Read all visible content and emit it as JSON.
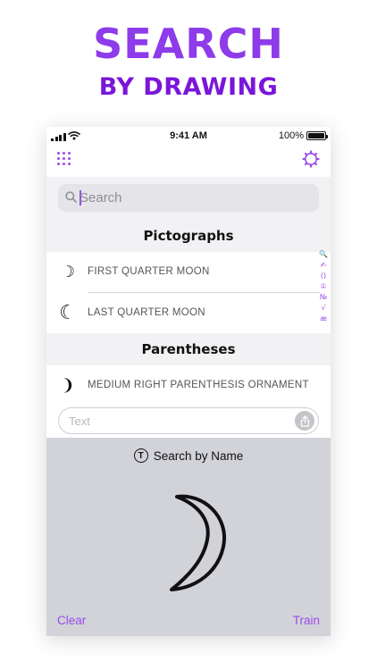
{
  "hero": {
    "title": "SEARCH",
    "subtitle": "BY DRAWING"
  },
  "status_bar": {
    "time": "9:41 AM",
    "battery": "100%"
  },
  "search": {
    "placeholder": "Search"
  },
  "sections": [
    {
      "title": "Pictographs",
      "rows": [
        {
          "glyph": "☽",
          "name": "FIRST QUARTER MOON"
        },
        {
          "glyph": "☾",
          "name": "LAST QUARTER MOON"
        }
      ]
    },
    {
      "title": "Parentheses",
      "rows": [
        {
          "glyph": "❩",
          "name": "MEDIUM RIGHT PARENTHESIS ORNAMENT"
        }
      ]
    }
  ],
  "index_bar": [
    "🔍",
    "✍",
    "()",
    "①",
    "№",
    "√",
    "æ"
  ],
  "text_field": {
    "placeholder": "Text"
  },
  "drawing_pad": {
    "title": "Search by Name",
    "title_icon": "T",
    "clear_label": "Clear",
    "train_label": "Train"
  },
  "colors": {
    "accent": "#9b4be8",
    "hero": "#8e3bea",
    "pad_bg": "#d2d3d9"
  }
}
